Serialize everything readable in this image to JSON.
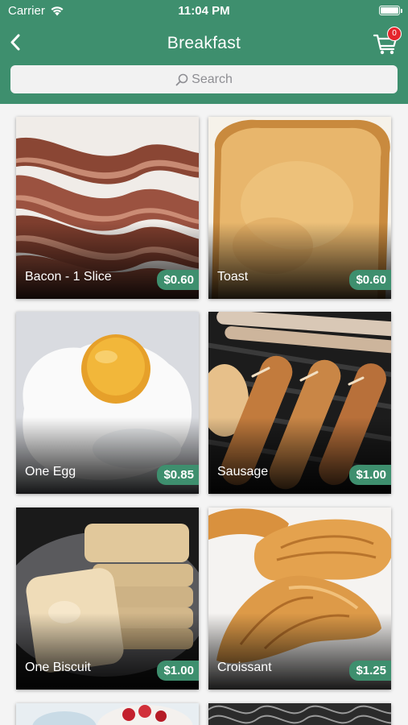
{
  "status_bar": {
    "carrier": "Carrier",
    "time": "11:04 PM"
  },
  "nav": {
    "title": "Breakfast",
    "cart_count": "0"
  },
  "search": {
    "placeholder": "Search"
  },
  "colors": {
    "brand_green": "#3e8f6e",
    "badge_red": "#e5262c"
  },
  "items": [
    {
      "name": "Bacon - 1 Slice",
      "price": "$0.60",
      "icon": "bacon-photo"
    },
    {
      "name": "Toast",
      "price": "$0.60",
      "icon": "toast-photo"
    },
    {
      "name": "One Egg",
      "price": "$0.85",
      "icon": "egg-photo"
    },
    {
      "name": "Sausage",
      "price": "$1.00",
      "icon": "sausage-photo"
    },
    {
      "name": "One Biscuit",
      "price": "$1.00",
      "icon": "biscuit-photo"
    },
    {
      "name": "Croissant",
      "price": "$1.25",
      "icon": "croissant-photo"
    }
  ]
}
